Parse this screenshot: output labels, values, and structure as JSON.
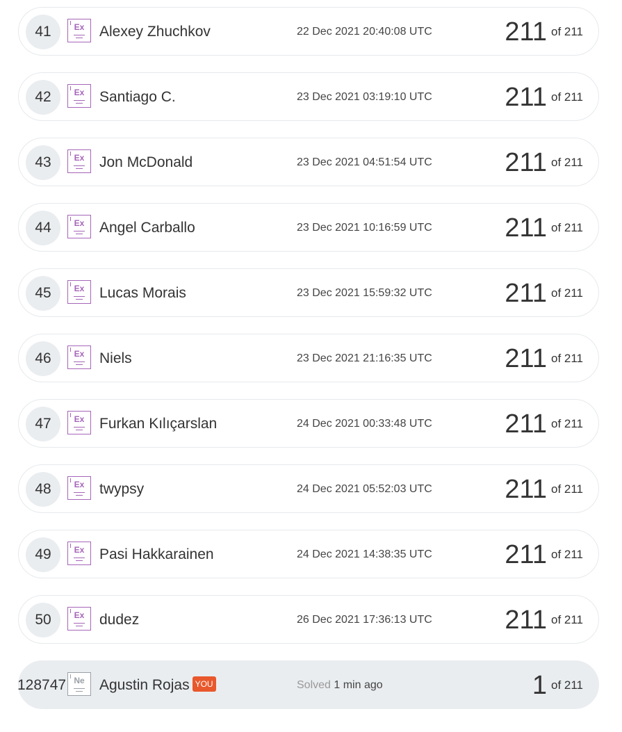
{
  "leaderboard": {
    "total": "211",
    "of_label": "of",
    "rows": [
      {
        "rank": "41",
        "badge": "Ex",
        "name": "Alexey Zhuchkov",
        "date": "22 Dec 2021 20:40:08 UTC",
        "score": "211"
      },
      {
        "rank": "42",
        "badge": "Ex",
        "name": "Santiago C.",
        "date": "23 Dec 2021 03:19:10 UTC",
        "score": "211"
      },
      {
        "rank": "43",
        "badge": "Ex",
        "name": "Jon McDonald",
        "date": "23 Dec 2021 04:51:54 UTC",
        "score": "211"
      },
      {
        "rank": "44",
        "badge": "Ex",
        "name": "Angel Carballo",
        "date": "23 Dec 2021 10:16:59 UTC",
        "score": "211"
      },
      {
        "rank": "45",
        "badge": "Ex",
        "name": "Lucas Morais",
        "date": "23 Dec 2021 15:59:32 UTC",
        "score": "211"
      },
      {
        "rank": "46",
        "badge": "Ex",
        "name": "Niels",
        "date": "23 Dec 2021 21:16:35 UTC",
        "score": "211"
      },
      {
        "rank": "47",
        "badge": "Ex",
        "name": "Furkan Kılıçarslan",
        "date": "24 Dec 2021 00:33:48 UTC",
        "score": "211"
      },
      {
        "rank": "48",
        "badge": "Ex",
        "name": "twypsy",
        "date": "24 Dec 2021 05:52:03 UTC",
        "score": "211"
      },
      {
        "rank": "49",
        "badge": "Ex",
        "name": "Pasi Hakkarainen",
        "date": "24 Dec 2021 14:38:35 UTC",
        "score": "211"
      },
      {
        "rank": "50",
        "badge": "Ex",
        "name": "dudez",
        "date": "26 Dec 2021 17:36:13 UTC",
        "score": "211"
      }
    ],
    "current_user": {
      "rank": "128747",
      "badge": "Ne",
      "name": "Agustin Rojas",
      "you_tag": "YOU",
      "solved_label": "Solved",
      "solved_time": "1 min ago",
      "score": "1"
    }
  },
  "colors": {
    "badge_expert": "#a565b8",
    "badge_newbie": "#9aa0a6",
    "you_tag": "#e8582c",
    "row_border": "#e6e9ec",
    "highlight_bg": "#eaedf0"
  },
  "icons": {
    "expert_badge": "expert-level-badge-icon",
    "newbie_badge": "newbie-level-badge-icon"
  }
}
